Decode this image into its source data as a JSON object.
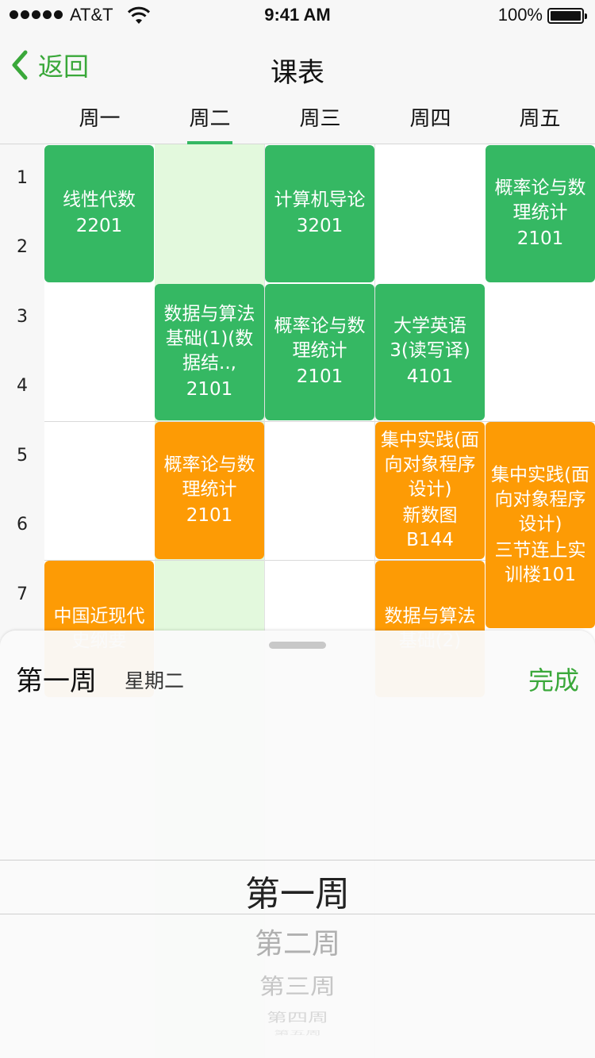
{
  "status_bar": {
    "carrier": "AT&T",
    "time": "9:41 AM",
    "battery": "100%",
    "battery_level": 1.0
  },
  "nav": {
    "back_label": "返回",
    "title": "课表"
  },
  "week_days": [
    "周一",
    "周二",
    "周三",
    "周四",
    "周五"
  ],
  "selected_day_index": 1,
  "periods": [
    "1",
    "2",
    "3",
    "4",
    "5",
    "6",
    "7"
  ],
  "courses": [
    {
      "day": 0,
      "start": 1,
      "span": 2,
      "name": "线性代数",
      "room": "2201",
      "color": "#35b863"
    },
    {
      "day": 2,
      "start": 1,
      "span": 2,
      "name": "计算机导论",
      "room": "3201",
      "color": "#35b863"
    },
    {
      "day": 4,
      "start": 1,
      "span": 2,
      "name": "概率论与数理统计",
      "room": "2101",
      "color": "#35b863"
    },
    {
      "day": 1,
      "start": 3,
      "span": 2,
      "name": "数据与算法基础(1)(数据结..,",
      "room": "2101",
      "color": "#35b863"
    },
    {
      "day": 2,
      "start": 3,
      "span": 2,
      "name": "概率论与数理统计",
      "room": "2101",
      "color": "#35b863"
    },
    {
      "day": 3,
      "start": 3,
      "span": 2,
      "name": "大学英语3(读写译)",
      "room": "4101",
      "color": "#35b863"
    },
    {
      "day": 1,
      "start": 5,
      "span": 2,
      "name": "概率论与数理统计",
      "room": "2101",
      "color": "#fd9b05"
    },
    {
      "day": 3,
      "start": 5,
      "span": 2,
      "name": "集中实践(面向对象程序设计)",
      "room": "新数图B144",
      "color": "#fd9b05"
    },
    {
      "day": 4,
      "start": 5,
      "span": 3,
      "name": "集中实践(面向对象程序设计)",
      "room": "三节连上实训楼101",
      "color": "#fd9b05"
    },
    {
      "day": 0,
      "start": 7,
      "span": 2,
      "name": "中国近现代史纲要",
      "room": "",
      "color": "#fd9b05"
    },
    {
      "day": 3,
      "start": 7,
      "span": 2,
      "name": "数据与算法基础(2)",
      "room": "",
      "color": "#fd9b05"
    }
  ],
  "picker": {
    "selected_week": "第一周",
    "selected_day": "星期二",
    "done_label": "完成",
    "options": [
      "第一周",
      "第二周",
      "第三周",
      "第四周",
      "第五周"
    ]
  },
  "colors": {
    "accent": "#3aa83a",
    "course_green": "#35b863",
    "course_orange": "#fd9b05",
    "today_bg": "#e3f9dd"
  }
}
